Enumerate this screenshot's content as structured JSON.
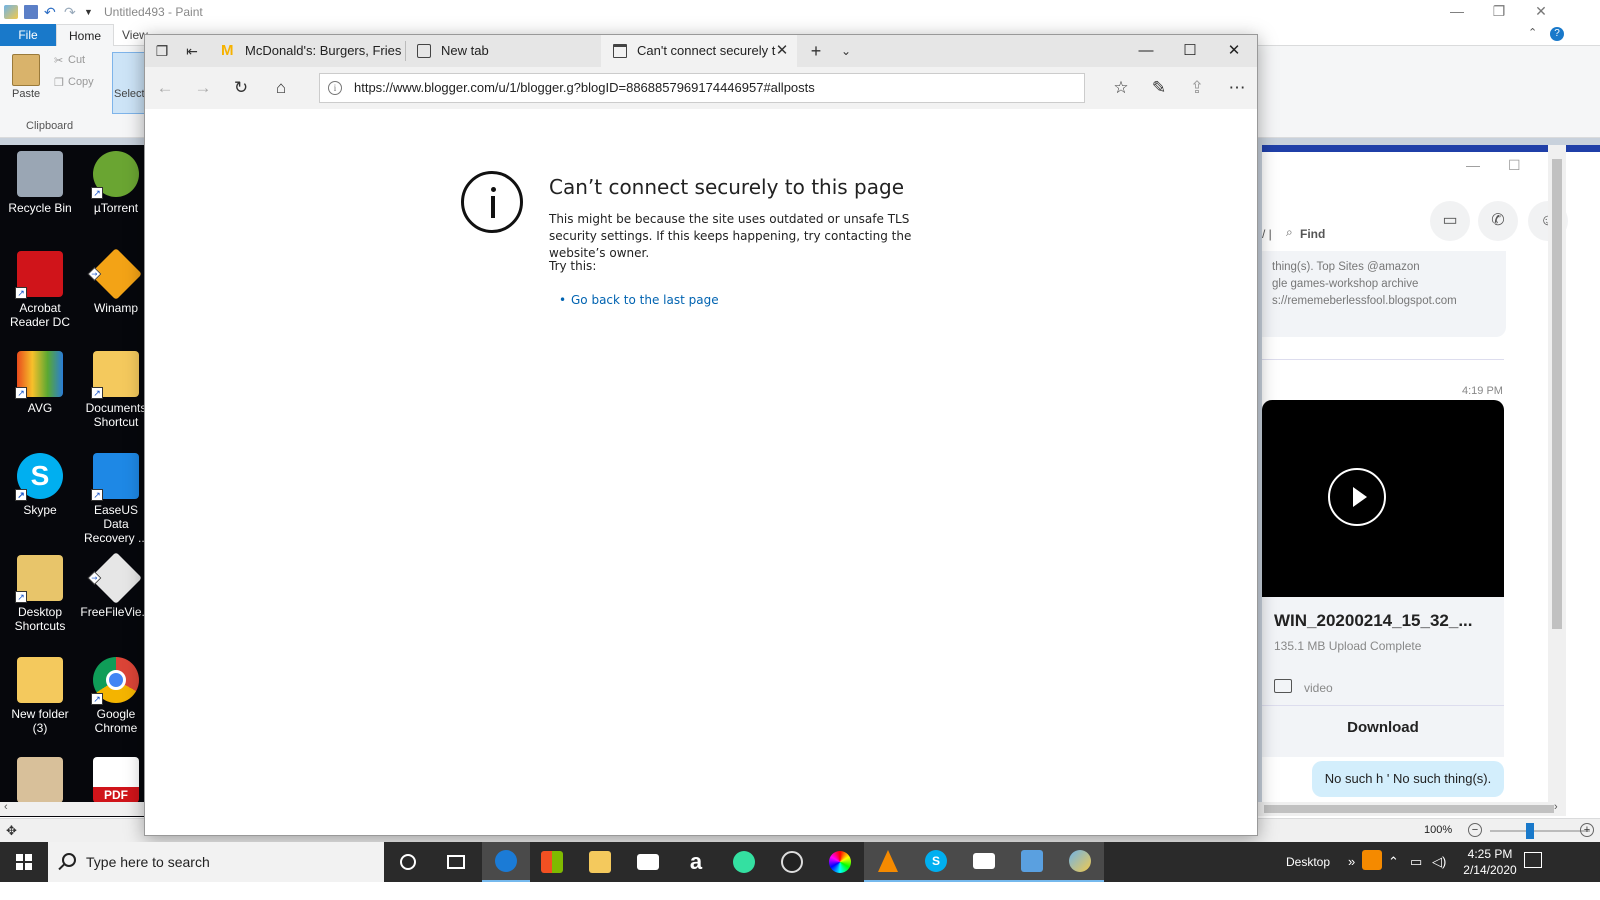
{
  "paint": {
    "title": "Untitled493 - Paint",
    "tabs": {
      "file": "File",
      "home": "Home",
      "view": "View"
    },
    "ribbon": {
      "paste": "Paste",
      "cut": "Cut",
      "copy": "Copy",
      "select": "Select",
      "clipboard_group": "Clipboard"
    },
    "status": {
      "zoom": "100%"
    }
  },
  "desktop_icons": [
    {
      "label": "Recycle Bin",
      "color": "#9aa6b4"
    },
    {
      "label": "µTorrent",
      "color": "#6aa532"
    },
    {
      "label": "Acrobat Reader DC",
      "color": "#d0141a"
    },
    {
      "label": "Winamp",
      "color": "#f3a316"
    },
    {
      "label": "AVG",
      "color": "#e84a1c"
    },
    {
      "label": "Documents Shortcut",
      "color": "#f4c95d"
    },
    {
      "label": "Skype",
      "color": "#00aff0"
    },
    {
      "label": "EaseUS Data Recovery ...",
      "color": "#1e88e5"
    },
    {
      "label": "Desktop Shortcuts",
      "color": "#e8c56a"
    },
    {
      "label": "FreeFileVie...",
      "color": "#e6e6e6"
    },
    {
      "label": "New folder (3)",
      "color": "#f4c95d"
    },
    {
      "label": "Google Chrome",
      "color": "#4285f4"
    },
    {
      "label": "",
      "color": "#d8c09a"
    },
    {
      "label": "PDF",
      "color": "#d0141a"
    }
  ],
  "skype": {
    "find": "Find",
    "card_lines": [
      "thing(s).   Top Sites     @amazon",
      "gle games-workshop archive",
      "s://rememeberlessfool.blogspot.com"
    ],
    "time": "4:19 PM",
    "file_name": "WIN_20200214_15_32_...",
    "file_size": "135.1 MB Upload Complete",
    "video_label": "video",
    "download": "Download",
    "message": "No such h ' No such thing(s)."
  },
  "edge": {
    "tabs": [
      {
        "title": "McDonald's: Burgers, Fries &",
        "active": false
      },
      {
        "title": "New tab",
        "active": false
      },
      {
        "title": "Can't connect securely t",
        "active": true
      }
    ],
    "url": "https://www.blogger.com/u/1/blogger.g?blogID=8868857969174446957#allposts",
    "error": {
      "title": "Can’t connect securely to this page",
      "body": "This might be because the site uses outdated or unsafe TLS security settings. If this keeps happening, try contacting the website’s owner.",
      "try_this": "Try this:",
      "bullet": "•",
      "link": "Go back to the last page"
    }
  },
  "taskbar": {
    "search_placeholder": "Type here to search",
    "desktop_label": "Desktop",
    "time": "4:25 PM",
    "date": "2/14/2020"
  }
}
